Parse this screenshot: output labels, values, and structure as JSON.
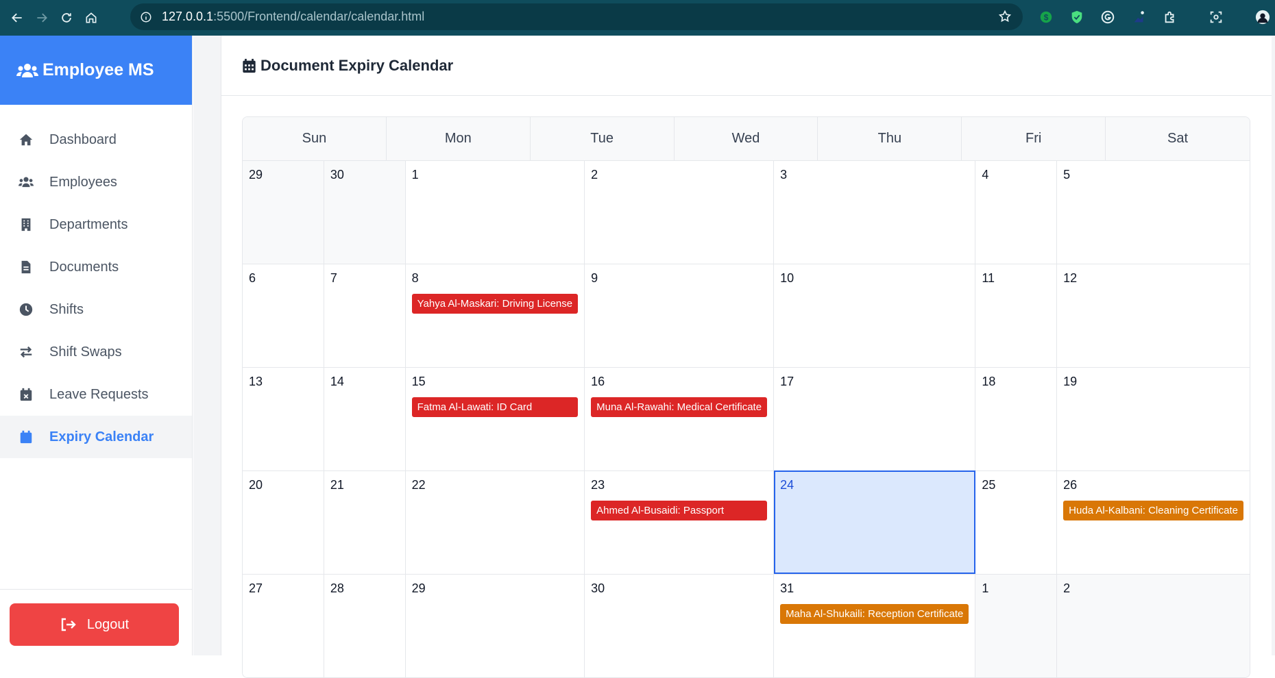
{
  "browser": {
    "url_host": "127.0.0.1",
    "url_rest": ":5500/Frontend/calendar/calendar.html"
  },
  "sidebar": {
    "brand": "Employee MS",
    "items": [
      {
        "label": "Dashboard",
        "icon": "home-icon"
      },
      {
        "label": "Employees",
        "icon": "users-icon"
      },
      {
        "label": "Departments",
        "icon": "building-icon"
      },
      {
        "label": "Documents",
        "icon": "file-icon"
      },
      {
        "label": "Shifts",
        "icon": "clock-icon"
      },
      {
        "label": "Shift Swaps",
        "icon": "swap-arrows-icon"
      },
      {
        "label": "Leave Requests",
        "icon": "calendar-x-icon"
      },
      {
        "label": "Expiry Calendar",
        "icon": "calendar-icon"
      }
    ],
    "active_index": 7,
    "logout": "Logout"
  },
  "main": {
    "title": "Document Expiry Calendar"
  },
  "colors": {
    "accent": "#3b82f6",
    "expired": "#dc2626",
    "warning": "#d97706",
    "today_bg": "#dbe8fd",
    "logout": "#ef4444",
    "browser": "#0f4c5c"
  },
  "calendar": {
    "weekdays": [
      "Sun",
      "Mon",
      "Tue",
      "Wed",
      "Thu",
      "Fri",
      "Sat"
    ],
    "days": [
      {
        "d": "29",
        "other": true
      },
      {
        "d": "30",
        "other": true
      },
      {
        "d": "1"
      },
      {
        "d": "2"
      },
      {
        "d": "3"
      },
      {
        "d": "4"
      },
      {
        "d": "5"
      },
      {
        "d": "6"
      },
      {
        "d": "7"
      },
      {
        "d": "8",
        "events": [
          {
            "text": "Yahya Al-Maskari: Driving License",
            "status": "expired"
          }
        ]
      },
      {
        "d": "9"
      },
      {
        "d": "10"
      },
      {
        "d": "11"
      },
      {
        "d": "12"
      },
      {
        "d": "13"
      },
      {
        "d": "14"
      },
      {
        "d": "15",
        "events": [
          {
            "text": "Fatma Al-Lawati: ID Card",
            "status": "expired"
          }
        ]
      },
      {
        "d": "16",
        "events": [
          {
            "text": "Muna Al-Rawahi: Medical Certificate",
            "status": "expired"
          }
        ]
      },
      {
        "d": "17"
      },
      {
        "d": "18"
      },
      {
        "d": "19"
      },
      {
        "d": "20"
      },
      {
        "d": "21"
      },
      {
        "d": "22"
      },
      {
        "d": "23",
        "events": [
          {
            "text": "Ahmed Al-Busaidi: Passport",
            "status": "expired"
          }
        ]
      },
      {
        "d": "24",
        "today": true
      },
      {
        "d": "25"
      },
      {
        "d": "26",
        "events": [
          {
            "text": "Huda Al-Kalbani: Cleaning Certificate",
            "status": "warning"
          }
        ]
      },
      {
        "d": "27"
      },
      {
        "d": "28"
      },
      {
        "d": "29"
      },
      {
        "d": "30"
      },
      {
        "d": "31",
        "events": [
          {
            "text": "Maha Al-Shukaili: Reception Certificate",
            "status": "warning"
          }
        ]
      },
      {
        "d": "1",
        "other": true
      },
      {
        "d": "2",
        "other": true
      }
    ]
  }
}
